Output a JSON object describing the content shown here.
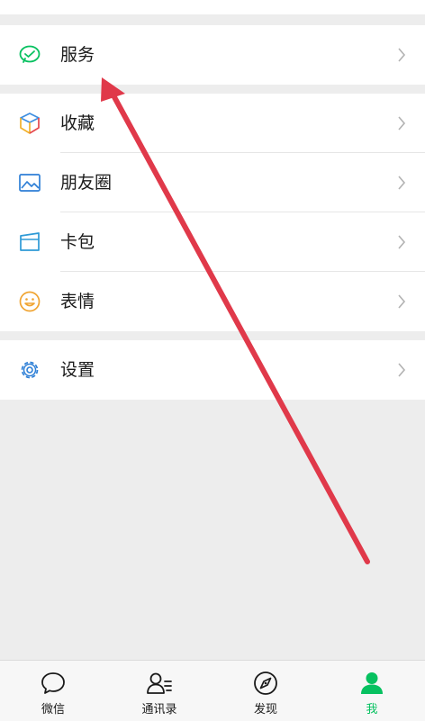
{
  "menu": {
    "service": {
      "label": "服务",
      "icon": "service-icon",
      "accent": "#07c160"
    },
    "items": [
      {
        "label": "收藏",
        "icon": "favorites-cube-icon"
      },
      {
        "label": "朋友圈",
        "icon": "moments-picture-icon"
      },
      {
        "label": "卡包",
        "icon": "card-wallet-icon"
      },
      {
        "label": "表情",
        "icon": "sticker-smile-icon"
      }
    ],
    "settings": {
      "label": "设置",
      "icon": "gear-icon"
    }
  },
  "tabbar": {
    "tabs": [
      {
        "label": "微信",
        "icon": "chat-bubble-icon",
        "active": false
      },
      {
        "label": "通讯录",
        "icon": "contacts-icon",
        "active": false
      },
      {
        "label": "发现",
        "icon": "compass-icon",
        "active": false
      },
      {
        "label": "我",
        "icon": "me-person-icon",
        "active": true
      }
    ],
    "active_color": "#07c160"
  },
  "annotation": {
    "arrow_color": "#e0394a"
  }
}
